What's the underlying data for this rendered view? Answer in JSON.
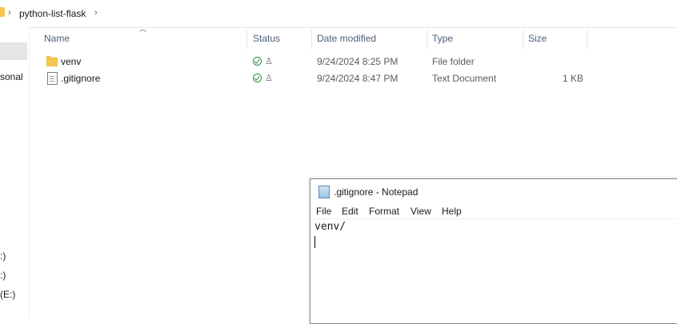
{
  "address": {
    "crumbs": [
      "python-list-flask"
    ]
  },
  "nav": {
    "items": [
      "sonal",
      ":)",
      ":)",
      "(E:)"
    ]
  },
  "columns": {
    "name": "Name",
    "status": "Status",
    "date": "Date modified",
    "type": "Type",
    "size": "Size"
  },
  "files": [
    {
      "name": "venv",
      "date": "9/24/2024 8:25 PM",
      "type": "File folder",
      "size": "",
      "icon": "folder-icon"
    },
    {
      "name": ".gitignore",
      "date": "9/24/2024 8:47 PM",
      "type": "Text Document",
      "size": "1 KB",
      "icon": "text-file-icon"
    }
  ],
  "notepad": {
    "title": ".gitignore - Notepad",
    "menu": [
      "File",
      "Edit",
      "Format",
      "View",
      "Help"
    ],
    "content": "venv/"
  },
  "colors": {
    "folder": "#f3c74d",
    "status_ok": "#2c8a3a",
    "header_text": "#4c607a"
  }
}
